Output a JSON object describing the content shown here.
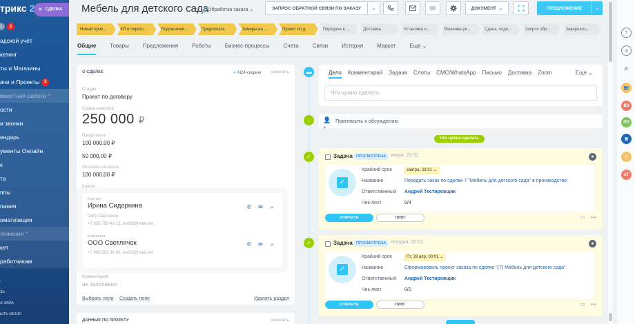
{
  "sidebar": {
    "logo_text": "трикс",
    "logo_num": "24",
    "close_label": "СДЕЛКА",
    "counters": [
      "1",
      "2"
    ],
    "items": [
      {
        "label": "адской учёт",
        "group": false
      },
      {
        "label": "кетинг",
        "group": false
      },
      {
        "label": "ты и Магазины",
        "group": false
      },
      {
        "label": "ачи и Проекты",
        "group": false,
        "badge": "2"
      },
      {
        "label": "вместная работа ^",
        "group": true
      },
      {
        "label": "ости",
        "group": false
      },
      {
        "label": "и звонки",
        "group": false
      },
      {
        "label": "ендарь",
        "group": false
      },
      {
        "label": "ументы Онлайн",
        "group": false
      },
      {
        "label": "к",
        "group": false
      },
      {
        "label": "та",
        "group": false
      },
      {
        "label": "ппы",
        "group": false
      },
      {
        "label": "пания",
        "group": false
      },
      {
        "label": "оматизация",
        "group": false
      },
      {
        "label": "ложения ^",
        "group": true
      },
      {
        "label": "кет",
        "group": false
      },
      {
        "label": "работчикам",
        "group": false
      }
    ],
    "bottom": [
      "-",
      "ЗЬ",
      "А ЗАЙА",
      "ЫТЬ МЕНЮ"
    ]
  },
  "header": {
    "title": "Мебель для детского сада",
    "category": "Обработка заказа",
    "feedback_label": "ЗАПРОС ОБРАТНОЙ СВЯЗИ ПО ЗАКАЗУ",
    "doc_label": "ДОКУМЕНТ",
    "offer_label": "ПРЕДЛОЖЕНИЕ"
  },
  "stages": [
    {
      "label": "Новый прое...",
      "done": true
    },
    {
      "label": "КП и перего...",
      "done": true
    },
    {
      "label": "Подписание...",
      "done": true
    },
    {
      "label": "Предоплата",
      "done": true
    },
    {
      "label": "Замеры на ...",
      "done": true
    },
    {
      "label": "Проект по д...",
      "done": true
    },
    {
      "label": "Передача в ...",
      "done": false
    },
    {
      "label": "Доставка",
      "done": false
    },
    {
      "label": "Установка и...",
      "done": false
    },
    {
      "label": "Решение ре...",
      "done": false
    },
    {
      "label": "Сдача, подп...",
      "done": false
    },
    {
      "label": "Запрос обр...",
      "done": false
    },
    {
      "label": "Завершить ...",
      "done": false
    }
  ],
  "tabs": [
    "Общие",
    "Товары",
    "Предложения",
    "Роботы",
    "Бизнес-процессы",
    "Счета",
    "Связи",
    "История",
    "Маркет",
    "Еще"
  ],
  "deal": {
    "section_title": "О СДЕЛКЕ",
    "ai_label": "AI24-скоринг",
    "edit_label": "изменить",
    "stage_label": "Стадия",
    "stage_value": "Проект по договору",
    "amount_label": "Сумма и валюта",
    "amount_value": "250 000",
    "currency": "₽",
    "prepay_label": "Предоплата",
    "prepay_value": "100 000,00 ₽",
    "second_value": "50 000,00 ₽",
    "remaining_label": "Осталось оплатить",
    "remaining_value": "100 000,00 ₽",
    "client_label": "Клиент",
    "contact_label": "Контакт",
    "contact_name": "Ирина Сидоркина",
    "contact_company": "ООО Светлячок",
    "contact_info": "+7 995 785-42-12, no008@mail.net",
    "company_label": "Компания",
    "company_name": "ООО Светлячок",
    "company_info": "+7 995 852-36-93, no023@mail.net",
    "comment_label": "Комментарий",
    "comment_value": "не заполнено",
    "select_field": "Выбрать поле",
    "create_field": "Создать поле",
    "delete_section": "Удалить раздел"
  },
  "project_data": {
    "title": "ДАННЫЕ ПО ПРОЕКТУ",
    "edit_label": "изменить"
  },
  "editor": {
    "tabs": [
      "Дело",
      "Комментарий",
      "Задача",
      "Слоты",
      "СМС/WhatsApp",
      "Письмо",
      "Доставка",
      "Zoom"
    ],
    "more": "Еще",
    "placeholder": "Что нужно сделать"
  },
  "invite_label": "Пригласить к обсуждению",
  "todo_pill": "Что нужно сделать",
  "tasks": [
    {
      "title": "Задача",
      "status": "ПРОСМОТРЕНА",
      "time": "вчера, 23:31",
      "deadline_label": "Крайний срок",
      "deadline": "завтра, 23:31",
      "name_label": "Название",
      "name": "Передать заказ по сделке 7 \"Мебель для детского сада\" в производство",
      "resp_label": "Ответственный",
      "resp": "Андрей Тестировщик",
      "check_label": "Чек-лист",
      "check": "0/4",
      "open_label": "ОТКРЫТЬ",
      "ping_label": "ПИНГ"
    },
    {
      "title": "Задача",
      "status": "ПРОСМОТРЕНА",
      "time": "сегодня, 00:01",
      "deadline_label": "Крайний срок",
      "deadline": "Пт, 28 апр, 00:01",
      "name_label": "Название",
      "name": "Сформировать проект заказа по сделке \"(7) Мебель для детского сада\"",
      "resp_label": "Ответственный",
      "resp": "Андрей Тестировщик",
      "check_label": "Чек-лист",
      "check": "0/2",
      "open_label": "ОТКРЫТЬ",
      "ping_label": "ПИНГ"
    }
  ],
  "right_bar": {
    "avatars": [
      {
        "label": "ВЗ",
        "color": "#f07a6a"
      },
      {
        "label": "ПП",
        "color": "#7ec35a"
      },
      {
        "label": "АТ",
        "color": "#f07a6a"
      }
    ]
  }
}
